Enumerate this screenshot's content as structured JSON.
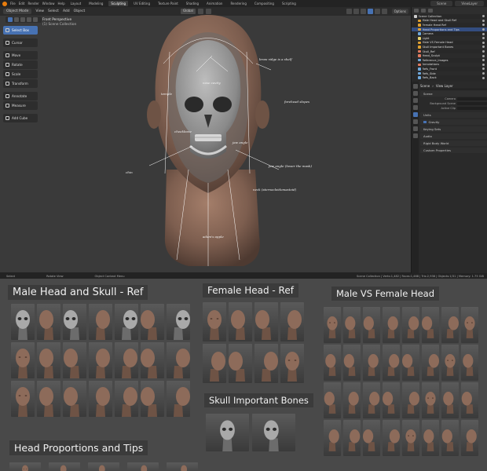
{
  "topbar": {
    "menus": [
      "File",
      "Edit",
      "Render",
      "Window",
      "Help"
    ],
    "workspaces": [
      "Layout",
      "Modeling",
      "Sculpting",
      "UV Editing",
      "Texture Paint",
      "Shading",
      "Animation",
      "Rendering",
      "Compositing",
      "Scripting"
    ],
    "active_workspace": "Sculpting",
    "scene": "Scene",
    "view_layer": "ViewLayer"
  },
  "viewport": {
    "mode": "Object Mode",
    "menus": [
      "View",
      "Select",
      "Add",
      "Object"
    ],
    "transform_orientation": "Global",
    "options": "Options",
    "perspective": "Front Perspective",
    "collection": "(1) Scene Collection",
    "tools": [
      {
        "label": "Select Box",
        "icon": "select-box-icon",
        "active": true
      },
      {
        "label": "Cursor",
        "icon": "cursor-icon"
      },
      {
        "label": "Move",
        "icon": "move-icon"
      },
      {
        "label": "Rotate",
        "icon": "rotate-icon"
      },
      {
        "label": "Scale",
        "icon": "scale-icon"
      },
      {
        "label": "Transform",
        "icon": "transform-icon"
      },
      {
        "label": "Annotate",
        "icon": "annotate-icon"
      },
      {
        "label": "Measure",
        "icon": "measure-icon"
      },
      {
        "label": "Add Cube",
        "icon": "add-cube-icon"
      }
    ],
    "annotations": [
      "brow ridge is a shelf",
      "temple",
      "forehead slopes",
      "nose cavity",
      "cheekbone",
      "jaw angle",
      "chin",
      "jaw angle (lower the mask)",
      "neck (sternocleidomastoid)",
      "adam's apple"
    ]
  },
  "outliner": {
    "rows": [
      {
        "name": "Scene Collection",
        "color": "#cccccc"
      },
      {
        "name": "Male Head and Skull Ref",
        "color": "#e0a030"
      },
      {
        "name": "Female Head Ref",
        "color": "#e0a030"
      },
      {
        "name": "Head Proportions and Tips",
        "color": "#e0a030",
        "selected": true
      },
      {
        "name": "Camera",
        "color": "#6fa8dc"
      },
      {
        "name": "Light",
        "color": "#e6d26f"
      },
      {
        "name": "Male VS Female Head",
        "color": "#e0a030"
      },
      {
        "name": "Skull Important Bones",
        "color": "#e0a030"
      },
      {
        "name": "Skull_Ref",
        "color": "#e07a5f"
      },
      {
        "name": "Head_Sculpt",
        "color": "#e07a5f"
      },
      {
        "name": "Reference_Images",
        "color": "#6fa8dc"
      },
      {
        "name": "Annotations",
        "color": "#e07a5f"
      },
      {
        "name": "Refs_Front",
        "color": "#6fa8dc"
      },
      {
        "name": "Refs_Side",
        "color": "#6fa8dc"
      },
      {
        "name": "Refs_Back",
        "color": "#6fa8dc"
      }
    ]
  },
  "properties": {
    "title": "Scene",
    "breadcrumb": "View Layer",
    "sections": [
      {
        "label": "Scene",
        "fields": [
          "Camera",
          "Background Scene",
          "Active Clip"
        ]
      },
      {
        "label": "Units",
        "fields": []
      },
      {
        "label": "Gravity",
        "fields": []
      },
      {
        "label": "Keying Sets",
        "fields": []
      },
      {
        "label": "Audio",
        "fields": []
      },
      {
        "label": "Rigid Body World",
        "fields": []
      },
      {
        "label": "Custom Properties",
        "fields": []
      }
    ]
  },
  "statusbar": {
    "left": "Select",
    "middle": "Rotate View",
    "context": "Object Context Menu",
    "right": "Scene Collection | Verts:1,482 | Faces:1,468 | Tris:2,936 | Objects:1/31 | Memory: 1.75 GiB"
  },
  "refsheet": {
    "titles": {
      "male": "Male Head and Skull - Ref",
      "female": "Female Head - Ref",
      "mvf": "Male VS Female Head",
      "skull": "Skull Important Bones",
      "props": "Head Proportions and Tips"
    }
  },
  "colors": {
    "accent": "#4772b3",
    "viewport_bg": "#3a3a3a",
    "skin": "#8d6b5a",
    "skull": "#9a9a9a"
  }
}
